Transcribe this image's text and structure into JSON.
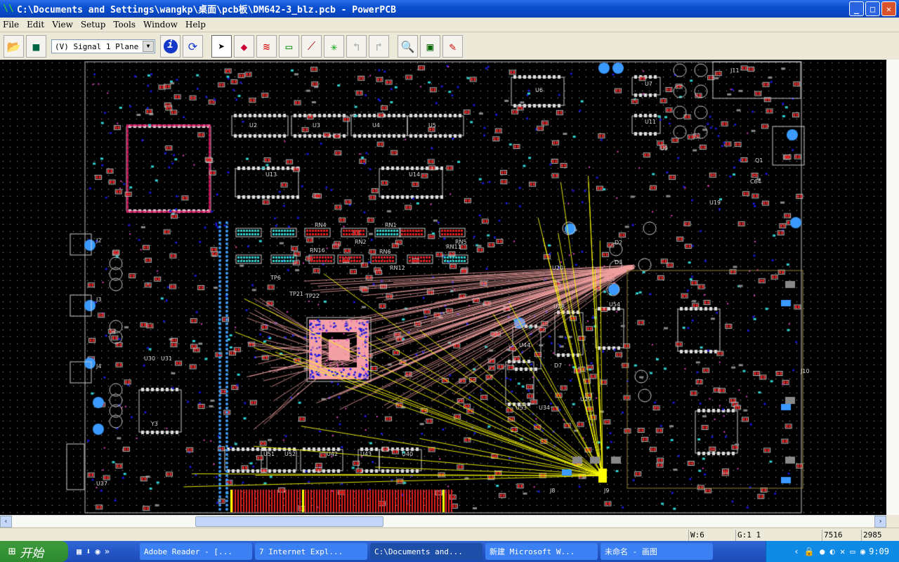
{
  "window": {
    "title": "C:\\Documents and Settings\\wangkp\\桌面\\pcb板\\DM642-3_blz.pcb - PowerPCB",
    "minimize": "_",
    "maximize": "□",
    "close": "✕"
  },
  "menu": [
    "File",
    "Edit",
    "View",
    "Setup",
    "Tools",
    "Window",
    "Help"
  ],
  "toolbar": {
    "layer_select": "(V) Signal 1 Plane",
    "buttons": [
      "open",
      "save",
      "info",
      "refresh",
      "select",
      "design",
      "route",
      "dimension",
      "ecn",
      "drc",
      "undo",
      "redo",
      "zoom",
      "cam",
      "verify"
    ]
  },
  "colors": {
    "board_bg": "#000000",
    "pad_red": "#e02020",
    "pad_cyan": "#30d0d0",
    "via_blue": "#1818e0",
    "ratsnest": "#f0a0a0",
    "outline": "#c0c0c0",
    "yellow": "#ffff00"
  },
  "board_labels": [
    "U2",
    "U3",
    "U4",
    "U5",
    "U6",
    "U7",
    "U11",
    "U13",
    "U14",
    "J2",
    "J3",
    "J4",
    "J11",
    "RN1",
    "RN2",
    "RN4",
    "RN5",
    "RN6",
    "RN11",
    "RN12",
    "RN16",
    "TP6",
    "TP21",
    "TP22",
    "U20",
    "U28",
    "U54",
    "D2",
    "D3",
    "D7",
    "U44",
    "U51",
    "U42",
    "U43",
    "U40",
    "U52",
    "U53",
    "U34",
    "U29",
    "U9",
    "U19",
    "J8",
    "J9",
    "J10",
    "Y3",
    "U30",
    "U31",
    "U37",
    "C64",
    "Q1"
  ],
  "status": {
    "width": "W:6",
    "grid": "G:1 1",
    "x": "7516",
    "y": "2985"
  },
  "taskbar": {
    "start": "开始",
    "tasks": [
      "Adobe Reader - [...",
      "7 Internet Expl...",
      "C:\\Documents and...",
      "新建 Microsoft W...",
      "未命名 - 画图"
    ],
    "active_task": 2,
    "clock": "9:09"
  }
}
